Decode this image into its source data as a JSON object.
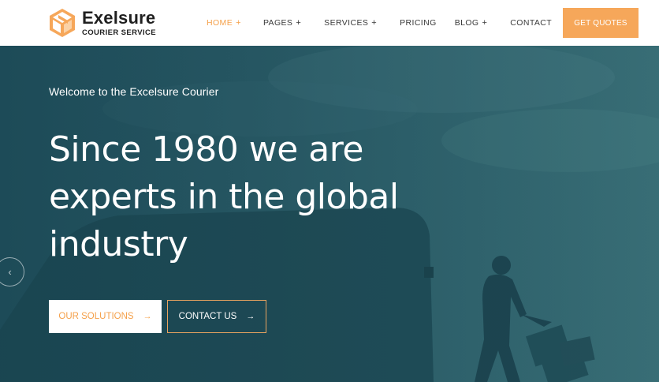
{
  "brand": {
    "name": "Exelsure",
    "tagline": "COURIER SERVICE",
    "accent_color": "#f6a75a"
  },
  "nav": {
    "items": [
      {
        "label": "HOME",
        "has_submenu": true,
        "active": true
      },
      {
        "label": "PAGES",
        "has_submenu": true,
        "active": false
      },
      {
        "label": "SERVICES",
        "has_submenu": true,
        "active": false
      },
      {
        "label": "PRICING",
        "has_submenu": false,
        "active": false
      },
      {
        "label": "BLOG",
        "has_submenu": true,
        "active": false
      },
      {
        "label": "CONTACT",
        "has_submenu": false,
        "active": false
      }
    ],
    "submenu_symbol": "+",
    "cta_label": "GET QUOTES"
  },
  "hero": {
    "welcome": "Welcome to the Excelsure Courier",
    "headline_lines": [
      "Since 1980 we are",
      "experts in the global",
      "industry"
    ],
    "primary_button": "OUR SOLUTIONS",
    "secondary_button": "CONTACT US",
    "arrow_glyph": "→",
    "prev_glyph": "‹",
    "overlay_color": "#2c5f6c"
  }
}
